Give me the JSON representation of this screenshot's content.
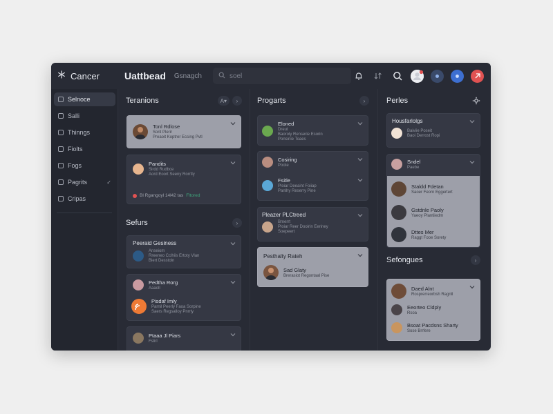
{
  "app": {
    "brand": "Cancer",
    "title": "Uattbead",
    "search_label": "Gsnagch",
    "search_placeholder": "soel"
  },
  "icons": {
    "brand": "snowflake-logo-icon",
    "search": "search-icon",
    "bell": "bell-icon",
    "sort": "sort-icon",
    "magnify": "magnifier-icon",
    "settings": "gear-icon",
    "chevron": "chevron-down-icon",
    "arrow": "chevron-right-icon"
  },
  "colors": {
    "accent_red": "#e05252",
    "accent_blue": "#3d6fd1",
    "green": "#3fa57b",
    "orange": "#ee7a35"
  },
  "sidebar": {
    "items": [
      {
        "label": "Selnoce",
        "active": true
      },
      {
        "label": "Salli"
      },
      {
        "label": "Thinngs"
      },
      {
        "label": "Fiolts"
      },
      {
        "label": "Fogs"
      },
      {
        "label": "Pagrits",
        "check": "✓"
      },
      {
        "label": "Cripas"
      }
    ]
  },
  "columns": {
    "left": {
      "title": "Teranions",
      "sort_chip": "A▾",
      "cards": [
        {
          "name": "Tonl Rdlose",
          "line1": "Sorit Plerir",
          "line2": "Preaoit Koptrer Ecsing Pvtl"
        },
        {
          "title": "Pandits",
          "name": "Sirdd Rudbce",
          "line2": "Aord Eoort Seeny Rorrtly",
          "status": "Bl Rgangoyl 14l42 tas",
          "status_green": "Fltored"
        }
      ],
      "section2_title": "Sefurs",
      "cards2": [
        {
          "title": "Peeraid Gesiness",
          "name": "Anseiom",
          "line1": "Rreeneo Cclhiis Ertoty Vlan",
          "line2": "Biert Desstoln"
        },
        {
          "name": "Pedtha Rorg",
          "line1": "Aaaoll"
        },
        {
          "name": "Pisdaf Imly",
          "line1": "Parnil Peerly Faoa Sorpine",
          "line2": "Saers Regsalloy Pnrrly"
        },
        {
          "name": "Ptaaa Jl Piars",
          "line1": "Fslirl"
        }
      ]
    },
    "middle": {
      "title": "Progarts",
      "cards": [
        {
          "name": "Eloned",
          "line1": "Dreut",
          "line2": "Baoroly Renserie Esorin",
          "line3": "Ponsinie Toaes"
        },
        {
          "name": "Cosiring",
          "line1": "Poote"
        },
        {
          "name": "Fsitle",
          "line1": "Ploiar Deeaint Foiiap",
          "line2": "Panlhy Reserry Pine"
        },
        {
          "title": "Pleazer PLCtreed",
          "name": "Bmerrt",
          "line1": "Ploiar Reer Dooirin Eeriney",
          "line2": "Soepeert"
        },
        {
          "title": "Pesthalty Rateh",
          "name": "Sad Glaty",
          "line1": "Brerasiot Regontaal Pise"
        }
      ]
    },
    "right": {
      "title": "Perles",
      "cards": [
        {
          "title": "Housfarlolgs",
          "name": "Baiviie Poseit",
          "line1": "Baoi Derrost Ropi"
        },
        {
          "name": "Sndel",
          "line1": "Paebe"
        }
      ],
      "light_list": [
        {
          "name": "Staldd Fdetan",
          "line1": "Saoer Feorn Eggertert"
        },
        {
          "name": "Gstdnle Paoly",
          "line1": "Yaeoy Plantiiedm"
        },
        {
          "name": "Dttes Mer",
          "line1": "Raggt Fooe Sorety"
        }
      ],
      "section2_title": "Sefongues",
      "list2": [
        {
          "name": "Daed Alnt",
          "line1": "Rosprerreorbsh Ragnll"
        },
        {
          "name": "Eeorteo Cldply",
          "line1": "Rsoa"
        },
        {
          "name": "Bsoat Pacdsns Sharty",
          "line1": "Sose Brrfere"
        }
      ]
    }
  }
}
